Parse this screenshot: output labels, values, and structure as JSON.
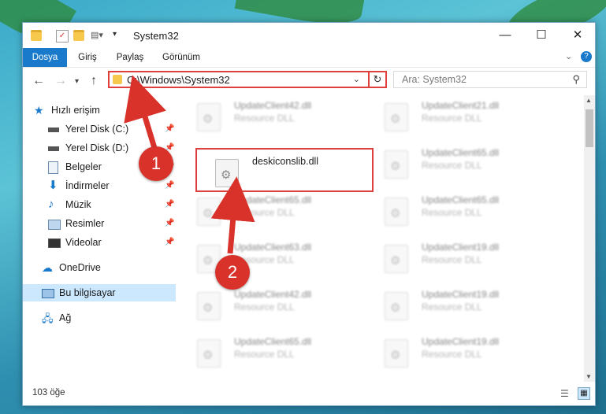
{
  "window": {
    "title": "System32",
    "ribbon_tabs": [
      "Dosya",
      "Giriş",
      "Paylaş",
      "Görünüm"
    ]
  },
  "address": {
    "path": "C:\\Windows\\System32",
    "search_placeholder": "Ara: System32"
  },
  "nav": {
    "items": [
      {
        "label": "Hızlı erişim",
        "icon": "star-icon"
      },
      {
        "label": "Yerel Disk (C:)",
        "icon": "drive-icon"
      },
      {
        "label": "Yerel Disk (D:)",
        "icon": "drive-icon"
      },
      {
        "label": "Belgeler",
        "icon": "documents-icon"
      },
      {
        "label": "İndirmeler",
        "icon": "download-icon"
      },
      {
        "label": "Müzik",
        "icon": "music-icon"
      },
      {
        "label": "Resimler",
        "icon": "pictures-icon"
      },
      {
        "label": "Videolar",
        "icon": "videos-icon"
      },
      {
        "label": "OneDrive",
        "icon": "cloud-icon"
      },
      {
        "label": "Bu bilgisayar",
        "icon": "computer-icon"
      },
      {
        "label": "Ağ",
        "icon": "network-icon"
      }
    ]
  },
  "files": {
    "highlighted": {
      "name": "deskiconslib.dll"
    },
    "items": [
      {
        "name": "UpdateClient42.dll",
        "type": "Resource DLL"
      },
      {
        "name": "UpdateClient21.dll",
        "type": "Resource DLL"
      },
      {
        "name": "UpdateClient65.dll",
        "type": "Resource DLL"
      },
      {
        "name": "UpdateClient65.dll",
        "type": "Resource DLL"
      },
      {
        "name": "UpdateClient65.dll",
        "type": "Resource DLL"
      },
      {
        "name": "UpdateClient63.dll",
        "type": "Resource DLL"
      },
      {
        "name": "UpdateClient19.dll",
        "type": "Resource DLL"
      },
      {
        "name": "UpdateClient42.dll",
        "type": "Resource DLL"
      },
      {
        "name": "UpdateClient19.dll",
        "type": "Resource DLL"
      },
      {
        "name": "UpdateClient65.dll",
        "type": "Resource DLL"
      },
      {
        "name": "UpdateClient19.dll",
        "type": "Resource DLL"
      }
    ]
  },
  "status": {
    "item_count": "103 öğe"
  },
  "annotations": {
    "marker1": "1",
    "marker2": "2",
    "color": "#d8322b"
  }
}
